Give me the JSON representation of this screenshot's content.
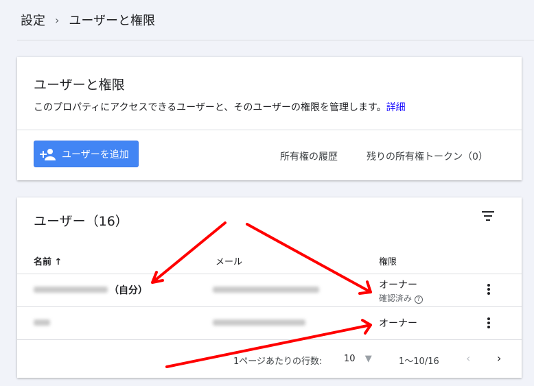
{
  "breadcrumb": {
    "parent": "設定",
    "separator": "›",
    "current": "ユーザーと権限"
  },
  "info_card": {
    "title": "ユーザーと権限",
    "description": "このプロパティにアクセスできるユーザーと、そのユーザーの権限を管理します。",
    "details_link": "詳細",
    "add_user_button": "ユーザーを追加",
    "ownership_history": "所有権の履歴",
    "remaining_tokens": "残りの所有権トークン（0）"
  },
  "users_card": {
    "title": "ユーザー（16）",
    "columns": {
      "name": "名前",
      "sort": "↑",
      "email": "メール",
      "role": "権限"
    },
    "rows": [
      {
        "self_label": "（自分）",
        "role": "オーナー",
        "status": "確認済み"
      },
      {
        "role": "オーナー"
      }
    ],
    "pagination": {
      "rows_label": "1ページあたりの行数:",
      "rows_per_page": "10",
      "range": "1〜10/16"
    }
  },
  "colors": {
    "accent": "#4285f4",
    "annotation": "#ff0000"
  }
}
